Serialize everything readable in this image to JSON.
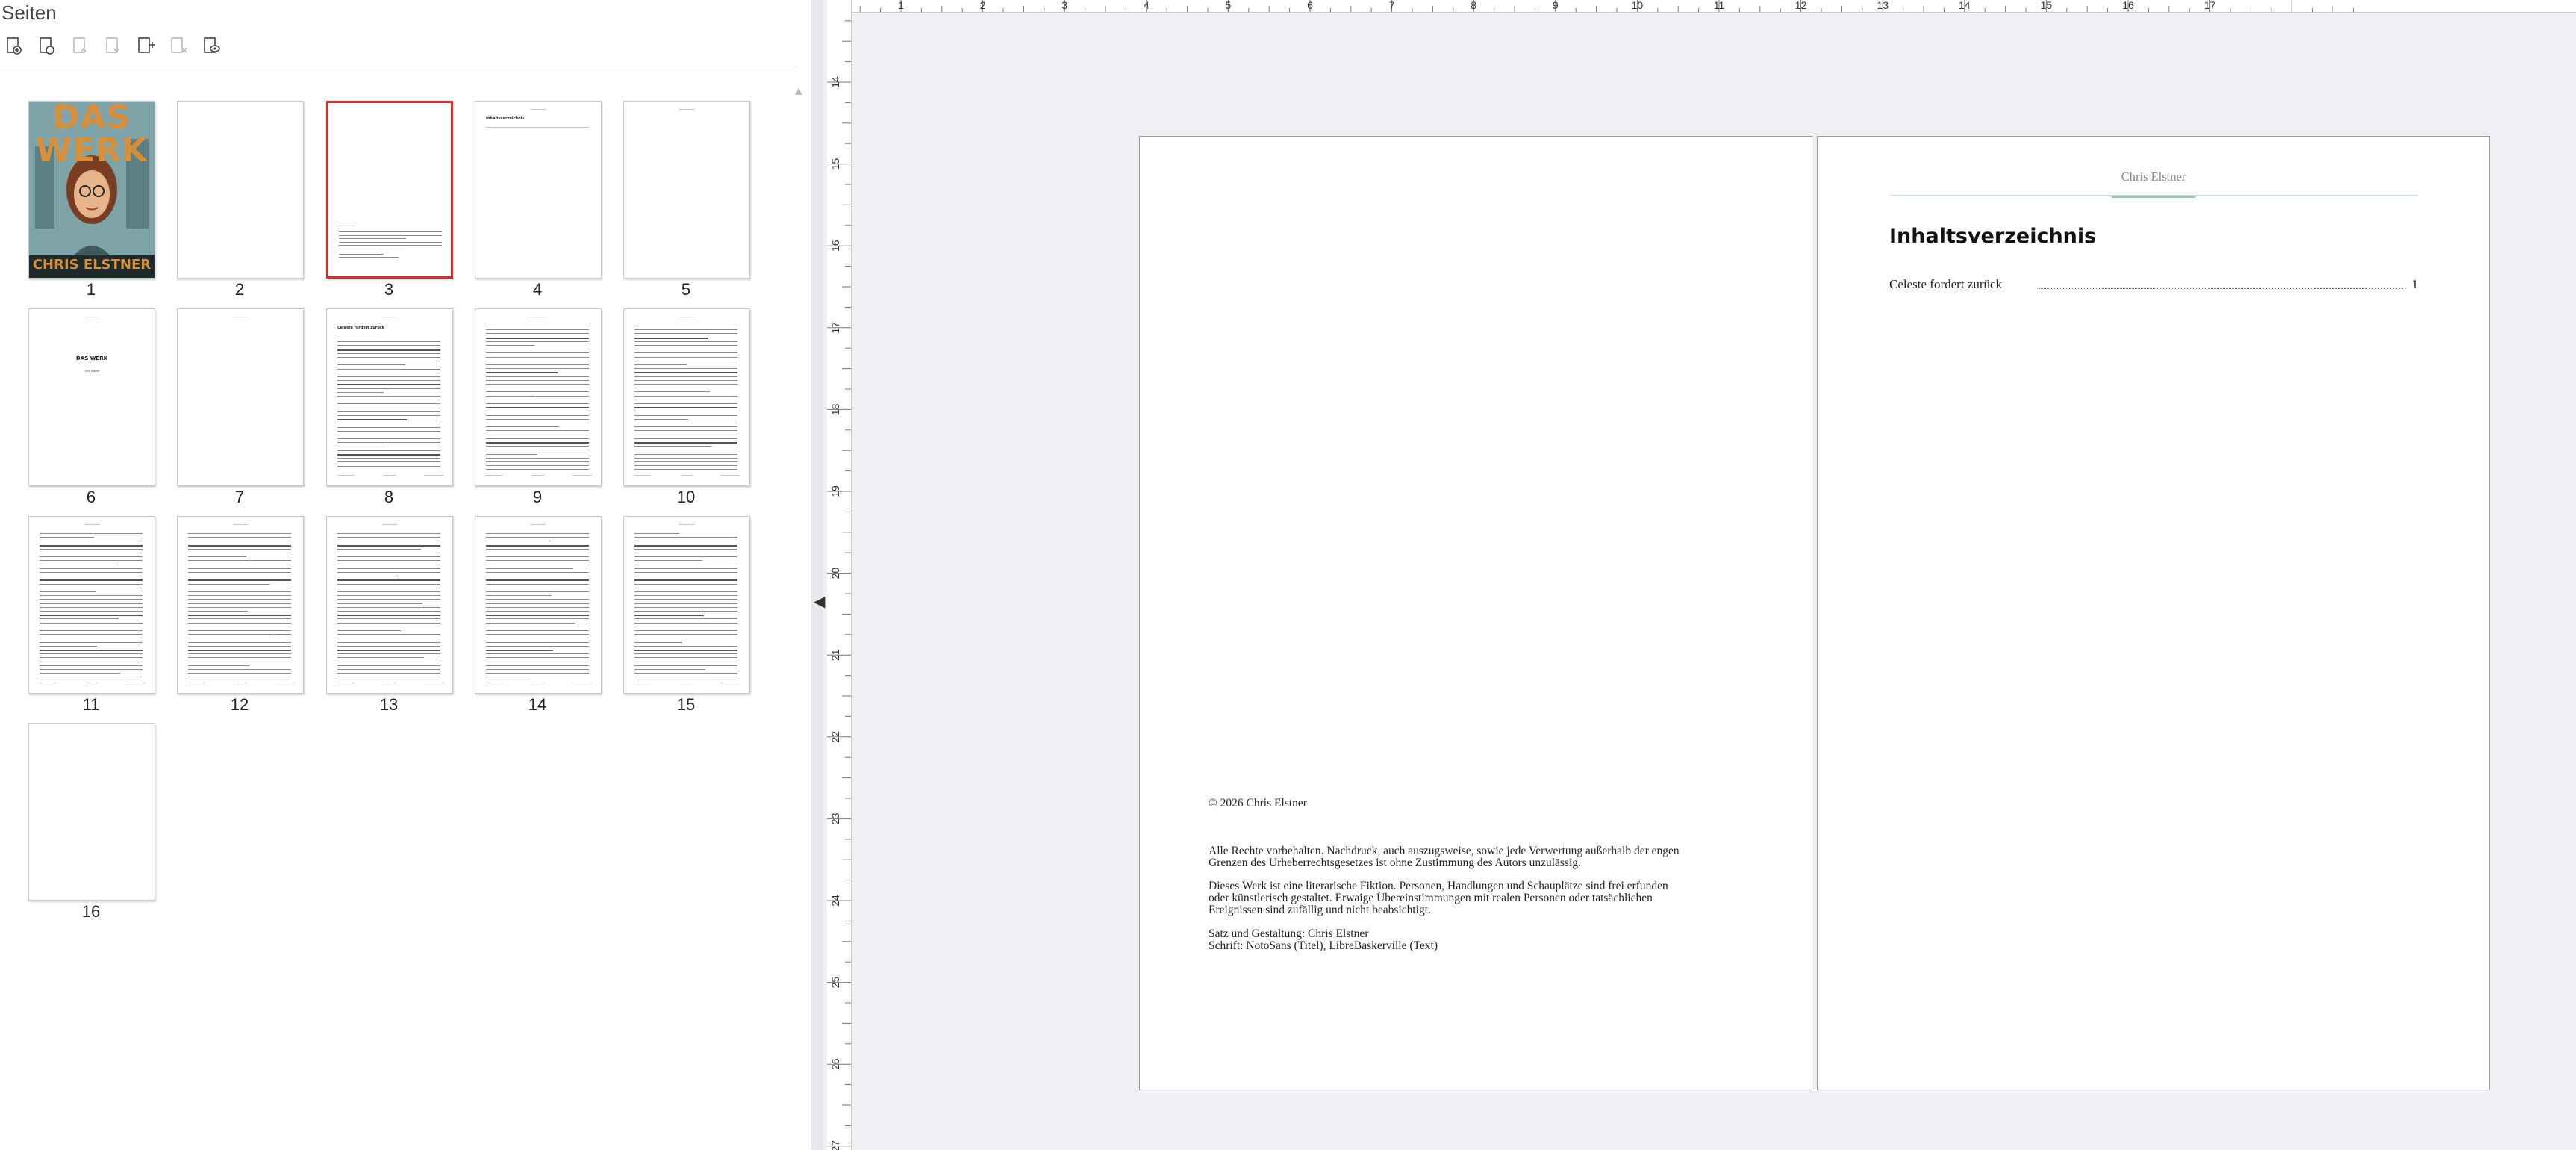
{
  "pane": {
    "title": "Seiten",
    "toolbar": [
      {
        "name": "new-page-button",
        "icon": "page-add-icon"
      },
      {
        "name": "duplicate-page-button",
        "icon": "page-duplicate-icon"
      },
      {
        "name": "move-page-up-button",
        "icon": "page-up-icon"
      },
      {
        "name": "move-page-down-button",
        "icon": "page-down-icon"
      },
      {
        "name": "insert-page-button",
        "icon": "page-insert-icon"
      },
      {
        "name": "delete-page-button",
        "icon": "page-delete-icon"
      },
      {
        "name": "page-visibility-button",
        "icon": "page-eye-icon"
      }
    ],
    "thumbnails": [
      {
        "label": "1",
        "kind": "cover"
      },
      {
        "label": "2",
        "kind": "blank"
      },
      {
        "label": "3",
        "kind": "imprint",
        "selected": true
      },
      {
        "label": "4",
        "kind": "toc"
      },
      {
        "label": "5",
        "kind": "header-only"
      },
      {
        "label": "6",
        "kind": "title"
      },
      {
        "label": "7",
        "kind": "header-only"
      },
      {
        "label": "8",
        "kind": "chapter-start"
      },
      {
        "label": "9",
        "kind": "text"
      },
      {
        "label": "10",
        "kind": "text"
      },
      {
        "label": "11",
        "kind": "text"
      },
      {
        "label": "12",
        "kind": "text"
      },
      {
        "label": "13",
        "kind": "text"
      },
      {
        "label": "14",
        "kind": "text"
      },
      {
        "label": "15",
        "kind": "text"
      },
      {
        "label": "16",
        "kind": "blank"
      }
    ],
    "cover": {
      "title": "DAS WERK",
      "author": "CHRIS ELSTNER",
      "colors": {
        "sky": "#7ea3a8",
        "title": "#d88f3a",
        "face": "#e8b48c",
        "hair": "#7a3d22",
        "coat": "#3f5a5e",
        "band": "#1f2a2c"
      }
    },
    "title_thumb": {
      "title": "DAS WERK",
      "subtitle": "Chris Elstner"
    },
    "toc_thumb": {
      "title": "Inhaltsverzeichnis"
    },
    "chapter_thumb": {
      "title": "Celeste fordert zurück"
    }
  },
  "ruler": {
    "horizontal_labels": [
      "1",
      "2",
      "3",
      "4",
      "5",
      "6",
      "7",
      "8",
      "9",
      "10",
      "11",
      "12",
      "13",
      "14",
      "15",
      "16",
      "17"
    ],
    "vertical_labels": [
      "14",
      "15",
      "16",
      "17",
      "18",
      "19",
      "20",
      "21",
      "22",
      "23",
      "24",
      "25",
      "26",
      "27"
    ]
  },
  "doc": {
    "left_page": {
      "copyright": "© 2026 Chris Elstner",
      "rights": [
        "Alle Rechte vorbehalten. Nachdruck, auch auszugsweise, sowie jede Verwertung außerhalb der engen",
        "Grenzen des Urheberrechtsgesetzes ist ohne Zustimmung des Autors unzulässig."
      ],
      "fiction": [
        "Dieses Werk ist eine literarische Fiktion. Personen, Handlungen und Schauplätze sind frei erfunden",
        "oder künstlerisch gestaltet. Erwaige Übereinstimmungen mit realen Personen oder tatsächlichen",
        "Ereignissen sind zufällig und nicht beabsichtigt."
      ],
      "credits": [
        "Satz und Gestaltung: Chris Elstner",
        "Schrift: NotoSans (Titel), LibreBaskerville (Text)"
      ]
    },
    "right_page": {
      "header": "Chris Elstner",
      "heading": "Inhaltsverzeichnis",
      "toc": [
        {
          "title": "Celeste fordert zurück",
          "page": "1"
        }
      ]
    }
  }
}
